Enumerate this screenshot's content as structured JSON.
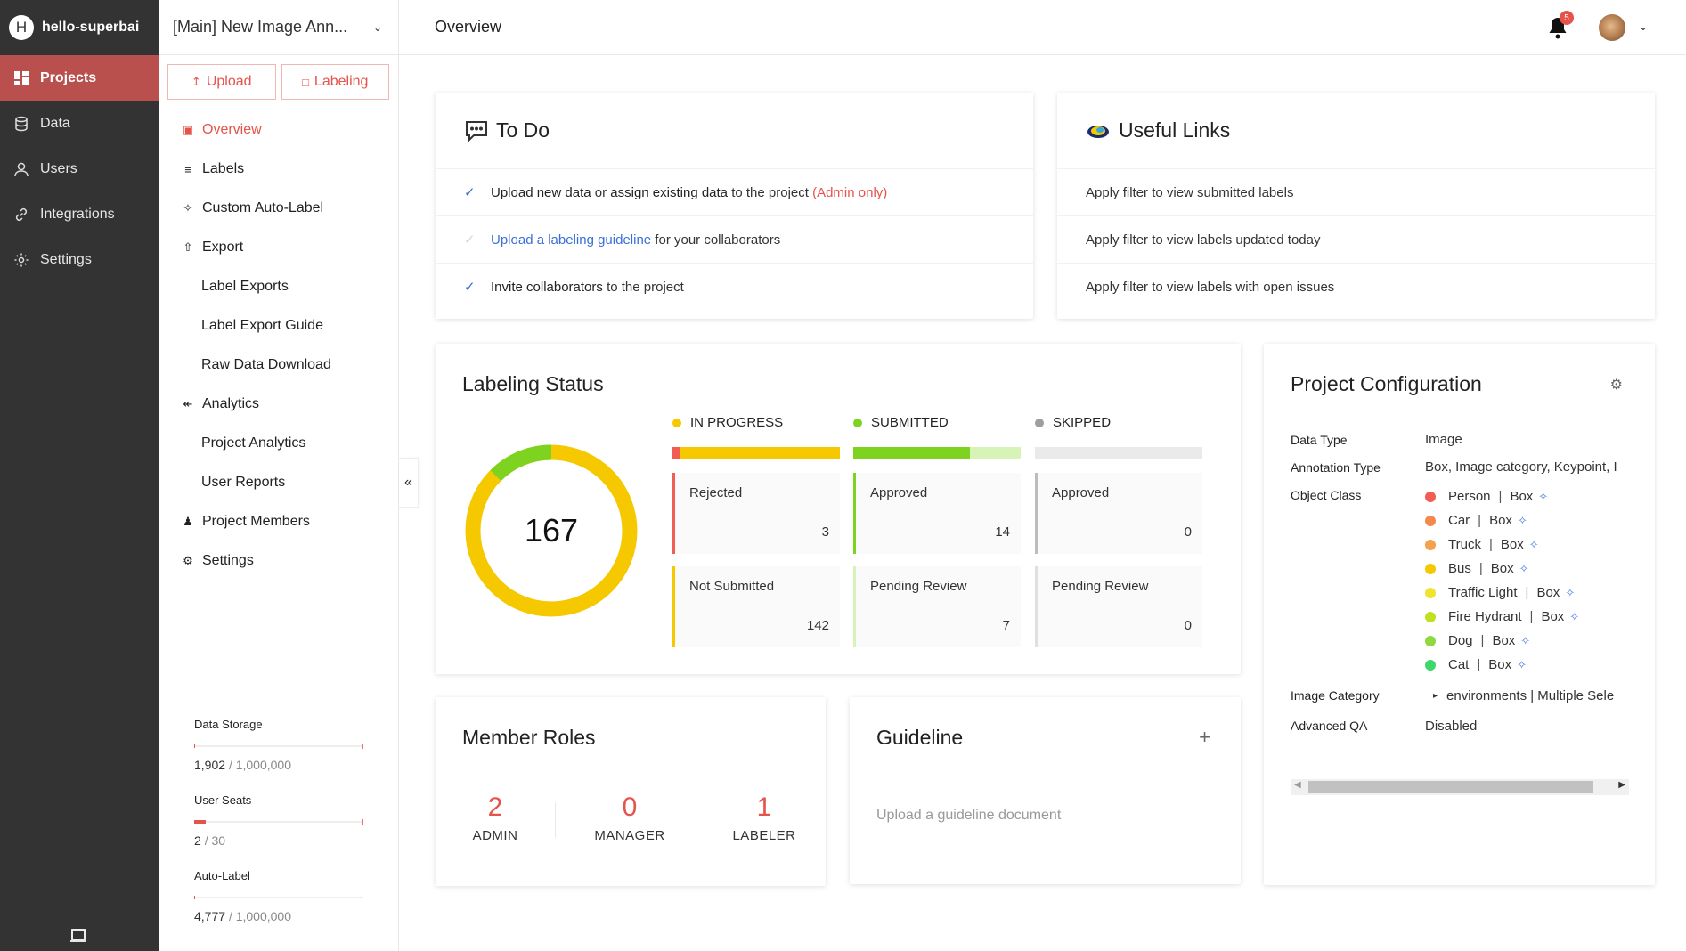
{
  "workspace": {
    "initial": "H",
    "name": "hello-superbai"
  },
  "sidebar": {
    "items": [
      {
        "label": "Projects",
        "icon": "grid-icon"
      },
      {
        "label": "Data",
        "icon": "database-icon"
      },
      {
        "label": "Users",
        "icon": "user-icon"
      },
      {
        "label": "Integrations",
        "icon": "link-icon"
      },
      {
        "label": "Settings",
        "icon": "gear-icon"
      }
    ],
    "active": "Projects"
  },
  "project": {
    "title": "[Main] New Image Ann..."
  },
  "actions": {
    "upload": "Upload",
    "labeling": "Labeling"
  },
  "subnav": {
    "items": [
      {
        "label": "Overview"
      },
      {
        "label": "Labels"
      },
      {
        "label": "Custom Auto-Label"
      },
      {
        "label": "Export"
      },
      {
        "label": "Label Exports"
      },
      {
        "label": "Label Export Guide"
      },
      {
        "label": "Raw Data Download"
      },
      {
        "label": "Analytics"
      },
      {
        "label": "Project Analytics"
      },
      {
        "label": "User Reports"
      },
      {
        "label": "Project Members"
      },
      {
        "label": "Settings"
      }
    ],
    "active": "Overview"
  },
  "usage": {
    "data_storage": {
      "label": "Data Storage",
      "used": "1,902",
      "total": "1,000,000",
      "fraction": 0.0019
    },
    "user_seats": {
      "label": "User Seats",
      "used": "2",
      "total": "30",
      "fraction": 0.0667
    },
    "auto_label": {
      "label": "Auto-Label",
      "used": "4,777",
      "total": "1,000,000",
      "fraction": 0.0048
    }
  },
  "header": {
    "page_title": "Overview",
    "notification_count": "5"
  },
  "todo": {
    "title": "To Do",
    "items": [
      {
        "parts": [
          "Upload new data",
          " or ",
          "assign existing data",
          " to the project ",
          "(Admin only)"
        ],
        "done": true
      },
      {
        "parts": [
          "Upload a labeling guideline",
          " for your collaborators"
        ],
        "done": false
      },
      {
        "parts": [
          "Invite collaborators",
          " to the project"
        ],
        "done": true
      }
    ]
  },
  "useful_links": {
    "title": "Useful Links",
    "items": [
      "Apply filter to view submitted labels",
      "Apply filter to view labels updated today",
      "Apply filter to view labels with open issues"
    ]
  },
  "labeling_status": {
    "title": "Labeling Status",
    "total": "167",
    "colors": {
      "in_progress": "#f5c800",
      "submitted": "#7ed321",
      "skipped": "#9e9e9e",
      "rejected": "#f25c54"
    },
    "columns": [
      {
        "name": "IN PROGRESS",
        "boxes": [
          {
            "label": "Rejected",
            "value": "3"
          },
          {
            "label": "Not Submitted",
            "value": "142"
          }
        ]
      },
      {
        "name": "SUBMITTED",
        "boxes": [
          {
            "label": "Approved",
            "value": "14"
          },
          {
            "label": "Pending Review",
            "value": "7"
          }
        ]
      },
      {
        "name": "SKIPPED",
        "boxes": [
          {
            "label": "Approved",
            "value": "0"
          },
          {
            "label": "Pending Review",
            "value": "0"
          }
        ]
      }
    ]
  },
  "project_config": {
    "title": "Project Configuration",
    "data_type": {
      "key": "Data Type",
      "value": "Image"
    },
    "annotation_type": {
      "key": "Annotation Type",
      "value": "Box, Image category, Keypoint, I"
    },
    "object_class": {
      "key": "Object Class",
      "items": [
        {
          "name": "Person",
          "type": "Box",
          "color": "#f25c54"
        },
        {
          "name": "Car",
          "type": "Box",
          "color": "#f5894c"
        },
        {
          "name": "Truck",
          "type": "Box",
          "color": "#f5a04c"
        },
        {
          "name": "Bus",
          "type": "Box",
          "color": "#f5c800"
        },
        {
          "name": "Traffic Light",
          "type": "Box",
          "color": "#f0e431"
        },
        {
          "name": "Fire Hydrant",
          "type": "Box",
          "color": "#c2e021"
        },
        {
          "name": "Dog",
          "type": "Box",
          "color": "#8ed840"
        },
        {
          "name": "Cat",
          "type": "Box",
          "color": "#3fd66a"
        }
      ]
    },
    "image_category": {
      "key": "Image Category",
      "value": "environments | Multiple Sele"
    },
    "advanced_qa": {
      "key": "Advanced QA",
      "value": "Disabled"
    }
  },
  "member_roles": {
    "title": "Member Roles",
    "roles": [
      {
        "count": "2",
        "name": "ADMIN"
      },
      {
        "count": "0",
        "name": "MANAGER"
      },
      {
        "count": "1",
        "name": "LABELER"
      }
    ]
  },
  "guideline": {
    "title": "Guideline",
    "empty_text": "Upload a guideline document"
  }
}
